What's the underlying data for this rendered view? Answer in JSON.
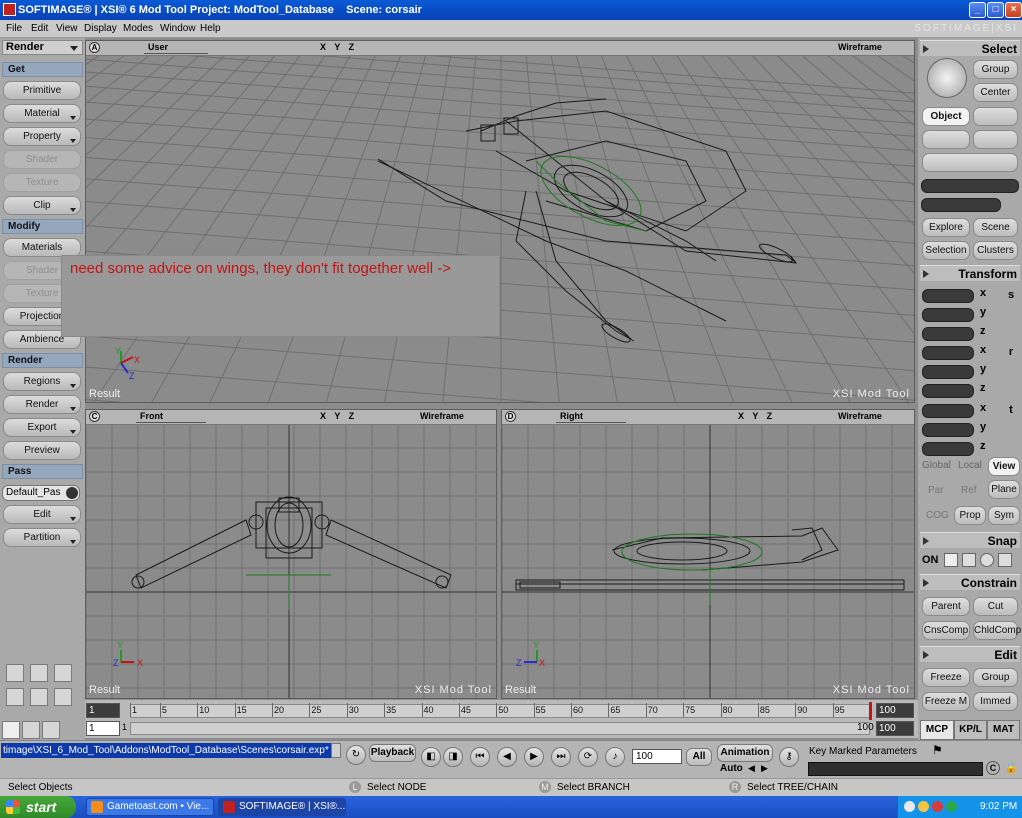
{
  "window": {
    "title": "SOFTIMAGE® | XSI® 6 Mod Tool Project: ModTool_Database    Scene: corsair",
    "brand": "SOFTIMAGE|XSI"
  },
  "menu": [
    "File",
    "Edit",
    "View",
    "Display",
    "Modes",
    "Window",
    "Help"
  ],
  "left_panel": {
    "selector": "Render",
    "sections": [
      {
        "header": "Get",
        "buttons": [
          {
            "label": "Primitive",
            "enabled": true
          },
          {
            "label": "Material",
            "enabled": true
          },
          {
            "label": "Property",
            "enabled": true
          },
          {
            "label": "Shader",
            "enabled": false
          },
          {
            "label": "Texture",
            "enabled": false
          },
          {
            "label": "Clip",
            "enabled": true
          }
        ]
      },
      {
        "header": "Modify",
        "buttons": [
          {
            "label": "Materials",
            "enabled": true
          },
          {
            "label": "Shader",
            "enabled": false
          },
          {
            "label": "Texture",
            "enabled": false
          },
          {
            "label": "Projection",
            "enabled": true
          },
          {
            "label": "Ambience",
            "enabled": true
          }
        ]
      },
      {
        "header": "Render",
        "buttons": [
          {
            "label": "Regions",
            "enabled": true
          },
          {
            "label": "Render",
            "enabled": true
          },
          {
            "label": "Export",
            "enabled": true
          },
          {
            "label": "Preview",
            "enabled": true
          }
        ]
      },
      {
        "header": "Pass",
        "select": "Default_Pas",
        "buttons": [
          {
            "label": "Edit",
            "enabled": true
          },
          {
            "label": "Partition",
            "enabled": true
          }
        ]
      }
    ]
  },
  "viewports": {
    "a": {
      "letter": "A",
      "camera": "User",
      "mode": "Wireframe",
      "axes": "X Y Z",
      "result": "Result",
      "watermark": "XSI Mod Tool"
    },
    "c": {
      "letter": "C",
      "camera": "Front",
      "mode": "Wireframe",
      "axes": "X Y Z",
      "result": "Result",
      "watermark": "XSI Mod Tool"
    },
    "d": {
      "letter": "D",
      "camera": "Right",
      "mode": "Wireframe",
      "axes": "X Y Z",
      "result": "Result",
      "watermark": "XSI Mod Tool"
    }
  },
  "annotation": "need some advice on wings, they don't fit together well ->",
  "right_panel": {
    "select_header": "Select",
    "group": "Group",
    "center": "Center",
    "object": "Object",
    "explore": "Explore",
    "scene": "Scene",
    "selection": "Selection",
    "clusters": "Clusters",
    "transform_header": "Transform",
    "axes": [
      "x",
      "y",
      "z"
    ],
    "transform_icons": [
      "s",
      "r",
      "t"
    ],
    "global": "Global",
    "local": "Local",
    "view": "View",
    "par": "Par",
    "ref": "Ref",
    "plane": "Plane",
    "cog": "COG",
    "prop": "Prop",
    "sym": "Sym",
    "snap_header": "Snap",
    "snap_on": "ON",
    "constrain_header": "Constrain",
    "parent": "Parent",
    "cut": "Cut",
    "cnscomp": "CnsComp",
    "chldcomp": "ChldComp",
    "edit_header": "Edit",
    "freeze": "Freeze",
    "group2": "Group",
    "freeze_m": "Freeze M",
    "immed": "Immed",
    "tabs": [
      "MCP",
      "KP/L",
      "MAT"
    ]
  },
  "timeline": {
    "start": "1",
    "end": "100",
    "range_start": "1",
    "range_start2": "1",
    "range_end": "100",
    "end2": "100",
    "ticks": [
      "1",
      "5",
      "10",
      "15",
      "20",
      "25",
      "30",
      "35",
      "40",
      "45",
      "50",
      "55",
      "60",
      "65",
      "70",
      "75",
      "80",
      "85",
      "90",
      "95"
    ],
    "current_frame": 99
  },
  "playback": {
    "path": "timage\\XSI_6_Mod_Tool\\Addons\\ModTool_Database\\Scenes\\corsair.exp*",
    "playback_label": "Playback",
    "frame": "100",
    "all_label": "All",
    "animation_label": "Animation",
    "auto_label": "Auto",
    "key_marked": "Key Marked Parameters"
  },
  "status": {
    "left": "Select Objects",
    "l_badge": "L",
    "l_text": "Select NODE",
    "m_badge": "M",
    "m_text": "Select BRANCH",
    "r_badge": "R",
    "r_text": "Select TREE/CHAIN"
  },
  "taskbar": {
    "start": "start",
    "tasks": [
      "Gametoast.com • Vie...",
      "SOFTIMAGE® | XSI®..."
    ],
    "clock": "9:02 PM"
  },
  "colors": {
    "accent_red": "#c41414",
    "title_blue": "#0a5ad6",
    "grid": "#6e6e6e",
    "wire_green": "#1e7a1e"
  }
}
